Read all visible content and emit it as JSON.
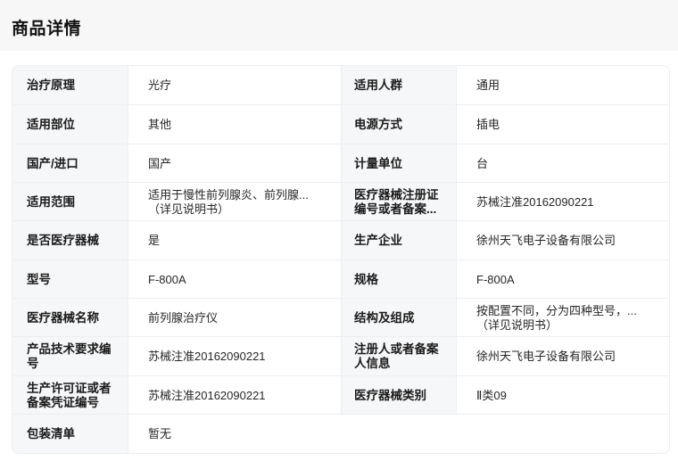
{
  "header": {
    "title": "商品详情"
  },
  "rows": [
    {
      "l1": "治疗原理",
      "v1": "光疗",
      "l2": "适用人群",
      "v2": "通用"
    },
    {
      "l1": "适用部位",
      "v1": "其他",
      "l2": "电源方式",
      "v2": "插电"
    },
    {
      "l1": "国产/进口",
      "v1": "国产",
      "l2": "计量单位",
      "v2": "台"
    },
    {
      "l1": "适用范围",
      "v1a": "适用于慢性前列腺炎、前列腺...",
      "v1b": "（详见说明书）",
      "l2a": "医疗器械注册证",
      "l2b": "编号或者备案...",
      "v2": "苏械注准20162090221"
    },
    {
      "l1": "是否医疗器械",
      "v1": "是",
      "l2": "生产企业",
      "v2": "徐州天飞电子设备有限公司"
    },
    {
      "l1": "型号",
      "v1": "F-800A",
      "l2": "规格",
      "v2": "F-800A"
    },
    {
      "l1": "医疗器械名称",
      "v1": "前列腺治疗仪",
      "l2": "结构及组成",
      "v2a": "按配置不同，分为四种型号，...",
      "v2b": "（详见说明书）"
    },
    {
      "l1a": "产品技术要求编",
      "l1b": "号",
      "v1": "苏械注准20162090221",
      "l2a": "注册人或者备案",
      "l2b": "人信息",
      "v2": "徐州天飞电子设备有限公司"
    },
    {
      "l1a": "生产许可证或者",
      "l1b": "备案凭证编号",
      "v1": "苏械注准20162090221",
      "l2": "医疗器械类别",
      "v2": "Ⅱ类09"
    },
    {
      "l1": "包装清单",
      "v1": "暂无"
    }
  ]
}
